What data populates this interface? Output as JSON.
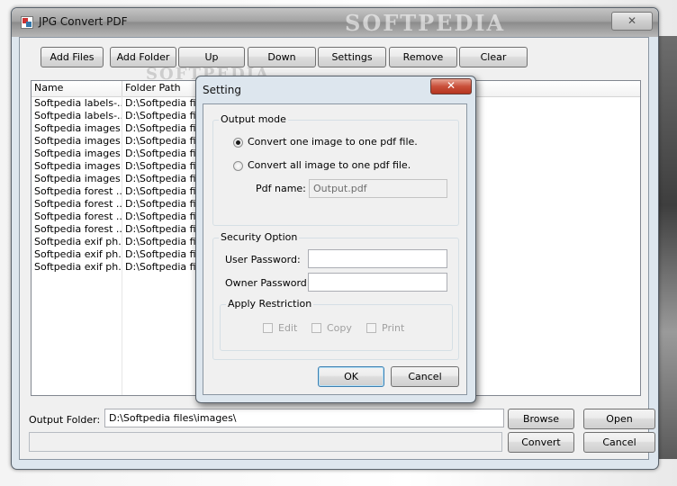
{
  "window": {
    "title": "JPG Convert PDF",
    "watermark": "SOFTPEDIA",
    "close_icon": "close-icon"
  },
  "toolbar": {
    "add_files": "Add Files",
    "add_folder": "Add Folder",
    "up": "Up",
    "down": "Down",
    "settings": "Settings",
    "remove": "Remove",
    "clear": "Clear"
  },
  "file_list": {
    "columns": [
      "Name",
      "Folder Path"
    ],
    "rows": [
      {
        "name": "Softpedia labels-...",
        "path": "D:\\Softpedia file"
      },
      {
        "name": "Softpedia labels-...",
        "path": "D:\\Softpedia file"
      },
      {
        "name": "Softpedia images...",
        "path": "D:\\Softpedia file"
      },
      {
        "name": "Softpedia images...",
        "path": "D:\\Softpedia file"
      },
      {
        "name": "Softpedia images...",
        "path": "D:\\Softpedia file"
      },
      {
        "name": "Softpedia images...",
        "path": "D:\\Softpedia file"
      },
      {
        "name": "Softpedia images...",
        "path": "D:\\Softpedia file"
      },
      {
        "name": "Softpedia forest ...",
        "path": "D:\\Softpedia file"
      },
      {
        "name": "Softpedia forest ...",
        "path": "D:\\Softpedia file"
      },
      {
        "name": "Softpedia forest ...",
        "path": "D:\\Softpedia file"
      },
      {
        "name": "Softpedia forest ...",
        "path": "D:\\Softpedia file"
      },
      {
        "name": "Softpedia exif ph...",
        "path": "D:\\Softpedia file"
      },
      {
        "name": "Softpedia exif ph...",
        "path": "D:\\Softpedia file"
      },
      {
        "name": "Softpedia exif ph...",
        "path": "D:\\Softpedia file"
      }
    ]
  },
  "output": {
    "label": "Output Folder:",
    "value": "D:\\Softpedia files\\images\\",
    "browse": "Browse",
    "open": "Open",
    "convert": "Convert",
    "cancel": "Cancel"
  },
  "dialog": {
    "title": "Setting",
    "output_mode": {
      "legend": "Output mode",
      "option_one": "Convert one image to one pdf file.",
      "option_all": "Convert all image to one pdf file.",
      "selected": "option_one",
      "pdf_name_label": "Pdf name:",
      "pdf_name_value": "Output.pdf"
    },
    "security": {
      "legend": "Security Option",
      "user_password_label": "User Password:",
      "owner_password_label": "Owner Password:",
      "user_password_value": "",
      "owner_password_value": ""
    },
    "restriction": {
      "legend": "Apply Restriction",
      "edit": "Edit",
      "copy": "Copy",
      "print": "Print"
    },
    "ok": "OK",
    "cancel": "Cancel"
  }
}
